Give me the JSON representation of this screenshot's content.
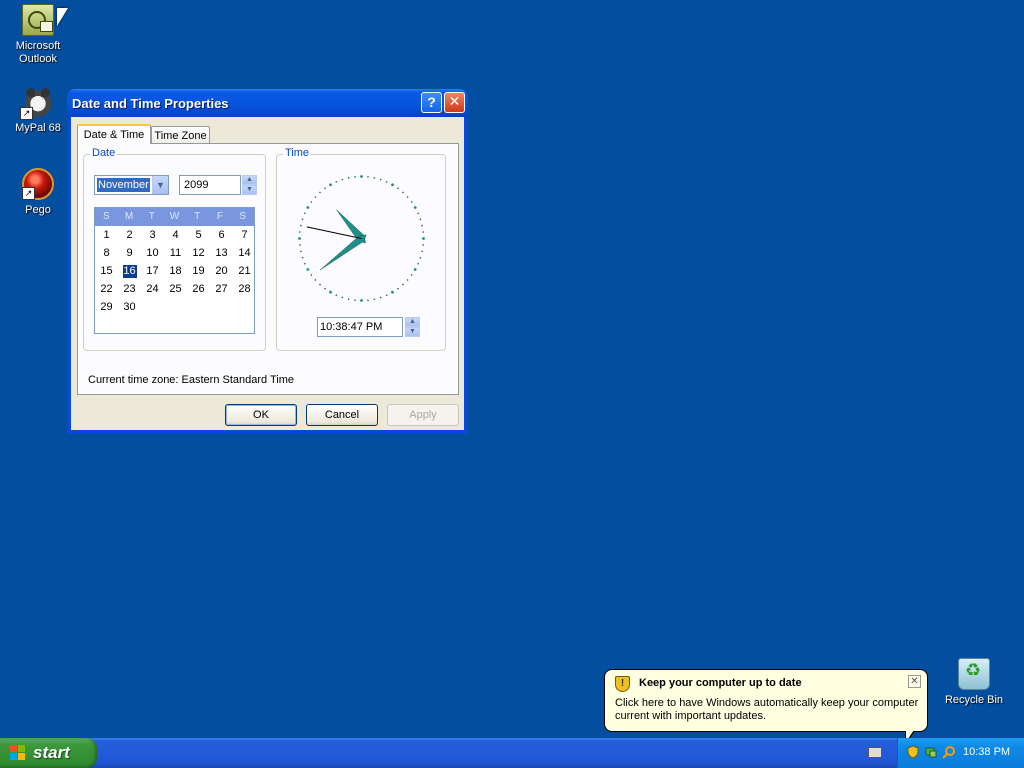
{
  "desktop": {
    "icons": [
      {
        "label": "Microsoft Outlook",
        "icon": "outlook-icon"
      },
      {
        "label": "MyPal 68",
        "icon": "mypal-icon"
      },
      {
        "label": "Pego",
        "icon": "pego-icon"
      },
      {
        "label": "Recycle Bin",
        "icon": "recycle-bin-icon"
      }
    ]
  },
  "window": {
    "title": "Date and Time Properties",
    "help_icon": "?",
    "close_icon": "✕",
    "tabs": [
      {
        "label": "Date & Time",
        "active": true
      },
      {
        "label": "Time Zone",
        "active": false
      }
    ],
    "date_group": {
      "label": "Date",
      "month": "November",
      "year": "2099",
      "weekdays": [
        "S",
        "M",
        "T",
        "W",
        "T",
        "F",
        "S"
      ],
      "selected_day": "16",
      "calendar_rows": [
        [
          "1",
          "2",
          "3",
          "4",
          "5",
          "6",
          "7"
        ],
        [
          "8",
          "9",
          "10",
          "11",
          "12",
          "13",
          "14"
        ],
        [
          "15",
          "16",
          "17",
          "18",
          "19",
          "20",
          "21"
        ],
        [
          "22",
          "23",
          "24",
          "25",
          "26",
          "27",
          "28"
        ],
        [
          "29",
          "30",
          "",
          "",
          "",
          "",
          ""
        ]
      ]
    },
    "time_group": {
      "label": "Time",
      "time_value": "10:38:47 PM"
    },
    "timezone_text": "Current time zone:  Eastern Standard Time",
    "buttons": {
      "ok": "OK",
      "cancel": "Cancel",
      "apply": "Apply"
    }
  },
  "balloon": {
    "title": "Keep your computer up to date",
    "text": "Click here to have Windows automatically keep your computer current with important updates.",
    "close": "✕"
  },
  "taskbar": {
    "start_label": "start",
    "clock": "10:38 PM"
  },
  "colors": {
    "desktop": "#044ea0",
    "titlebar": "#0754dd",
    "taskbar": "#245edb",
    "start": "#3c9a3c",
    "tab_accent": "#ffc83c",
    "clock_hand": "#1f8f8a"
  }
}
